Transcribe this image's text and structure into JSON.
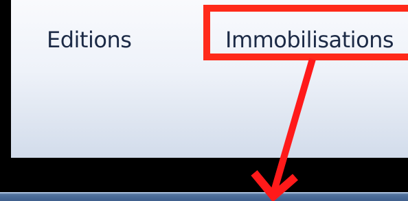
{
  "menu": {
    "items": [
      {
        "label": "Editions"
      },
      {
        "label": "Immobilisations"
      }
    ]
  },
  "annotation": {
    "highlight_color": "#ff2a1a",
    "arrow_color": "#ff1a1a"
  }
}
